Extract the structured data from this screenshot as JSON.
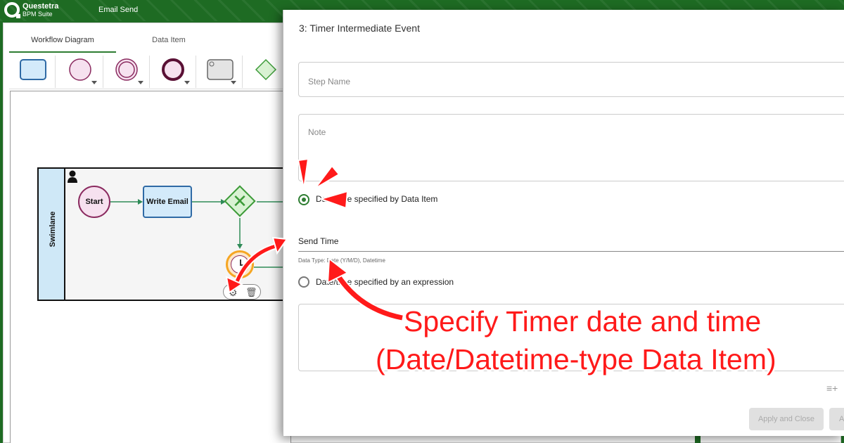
{
  "app": {
    "brand_line1": "Questetra",
    "brand_line2": "BPM Suite",
    "process_name": "Email Send"
  },
  "editor": {
    "tabs": [
      {
        "label": "Workflow Diagram",
        "active": true
      },
      {
        "label": "Data Item",
        "active": false
      }
    ],
    "palette": [
      "task-tool-icon",
      "start-event-tool-icon",
      "intermediate-event-tool-icon",
      "end-event-tool-icon",
      "subprocess-tool-icon",
      "gateway-tool-icon"
    ],
    "diagram": {
      "lane_label": "Swimlane",
      "start_label": "Start",
      "task_label": "Write Email"
    }
  },
  "dialog": {
    "title": "3: Timer Intermediate Event",
    "step_name_placeholder": "Step Name",
    "note_placeholder": "Note",
    "radio_data_item_label": "Date/time specified by Data Item",
    "radio_data_item_checked": true,
    "send_time_value": "Send Time",
    "data_type_helper": "Data Type: Date (Y/M/D), Datetime",
    "radio_expression_label": "Date/time specified by an expression",
    "radio_expression_checked": false,
    "buttons": {
      "apply_close": "Apply and Close",
      "apply": "Apply"
    }
  },
  "annotation": {
    "line1": "Specify Timer date and time",
    "line2": "(Date/Datetime-type Data Item)",
    "color": "#ff1a1a"
  },
  "colors": {
    "brand_green": "#1e6b23",
    "accent_green": "#2e7d32"
  }
}
